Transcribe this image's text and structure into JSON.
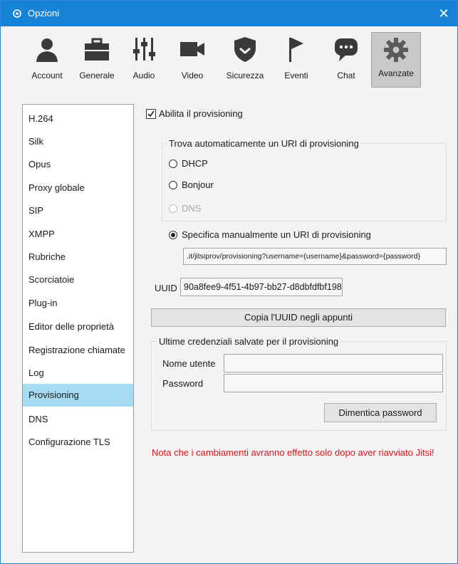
{
  "window": {
    "title": "Opzioni",
    "close_glyph": "✕",
    "accent": "#1683d8"
  },
  "toolbar": [
    {
      "label": "Account",
      "icon": "person-icon"
    },
    {
      "label": "Generale",
      "icon": "briefcase-icon"
    },
    {
      "label": "Audio",
      "icon": "sliders-icon"
    },
    {
      "label": "Video",
      "icon": "camera-icon"
    },
    {
      "label": "Sicurezza",
      "icon": "shield-icon"
    },
    {
      "label": "Eventi",
      "icon": "flag-icon"
    },
    {
      "label": "Chat",
      "icon": "chat-bubble-icon"
    },
    {
      "label": "Avanzate",
      "icon": "gear-icon"
    }
  ],
  "sidebar": {
    "items": [
      "H.264",
      "Silk",
      "Opus",
      "Proxy globale",
      "SIP",
      "XMPP",
      "Rubriche",
      "Scorciatoie",
      "Plug-in",
      "Editor delle proprietà",
      "Registrazione chiamate",
      "Log",
      "Provisioning",
      "DNS",
      "Configurazione TLS"
    ],
    "selected": "Provisioning"
  },
  "provisioning": {
    "enable_label": "Abilita il provisioning",
    "enable_checked": true,
    "auto_group_title": "Trova automaticamente un URI di provisioning",
    "auto_options": [
      {
        "label": "DHCP",
        "checked": false,
        "disabled": false
      },
      {
        "label": "Bonjour",
        "checked": false,
        "disabled": false
      },
      {
        "label": "DNS",
        "checked": false,
        "disabled": true
      }
    ],
    "manual_label": "Specifica manualmente un URI di provisioning",
    "manual_checked": true,
    "manual_uri": ".it/jitsiprov/provisioning?username=(username}&password={password}",
    "uuid_label": "UUID",
    "uuid_value": "90a8fee9-4f51-4b97-bb27-d8dbfdfbf198",
    "copy_button": "Copia l'UUID negli appunti",
    "credentials_title": "Ultime credenziali salvate per il provisioning",
    "username_label": "Nome utente",
    "username_value": "",
    "password_label": "Password",
    "password_value": "",
    "forget_button": "Dimentica password",
    "restart_note": "Nota che i cambiamenti avranno effetto solo dopo aver riavviato Jitsi!",
    "note_color": "#e0141b"
  }
}
